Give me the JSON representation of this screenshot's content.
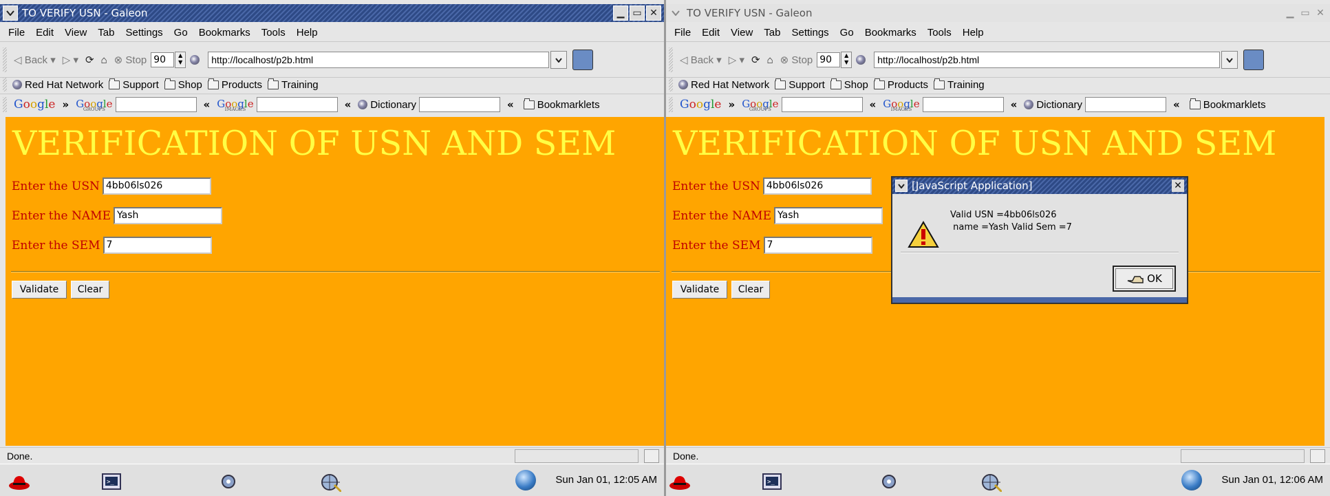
{
  "left": {
    "title": "TO VERIFY USN - Galeon",
    "menu": [
      "File",
      "Edit",
      "View",
      "Tab",
      "Settings",
      "Go",
      "Bookmarks",
      "Tools",
      "Help"
    ],
    "toolbar": {
      "back": "Back",
      "stop": "Stop",
      "zoom": "90",
      "url": "http://localhost/p2b.html"
    },
    "bookmarks": [
      "Red Hat Network",
      "Support",
      "Shop",
      "Products",
      "Training"
    ],
    "googlebar": {
      "dictionary": "Dictionary",
      "bookmarklets": "Bookmarklets",
      "chev": "»",
      "rev": "«",
      "groups": "GROUPS",
      "images": "IMAGES",
      "google": "Google"
    },
    "page": {
      "heading": "VERIFICATION OF USN AND SEM",
      "usn_label": "Enter the USN",
      "usn_value": "4bb06ls026",
      "name_label": "Enter the NAME",
      "name_value": "Yash",
      "sem_label": "Enter the SEM",
      "sem_value": "7",
      "validate": "Validate",
      "clear": "Clear"
    },
    "status": "Done.",
    "clock": "Sun Jan 01, 12:05 AM"
  },
  "right": {
    "title": "TO VERIFY USN - Galeon",
    "menu": [
      "File",
      "Edit",
      "View",
      "Tab",
      "Settings",
      "Go",
      "Bookmarks",
      "Tools",
      "Help"
    ],
    "toolbar": {
      "back": "Back",
      "stop": "Stop",
      "zoom": "90",
      "url": "http://localhost/p2b.html"
    },
    "bookmarks": [
      "Red Hat Network",
      "Support",
      "Shop",
      "Products",
      "Training"
    ],
    "googlebar": {
      "dictionary": "Dictionary",
      "bookmarklets": "Bookmarklets",
      "chev": "»",
      "rev": "«",
      "groups": "GROUPS",
      "images": "IMAGES",
      "google": "Google"
    },
    "page": {
      "heading": "VERIFICATION OF USN AND SEM",
      "usn_label": "Enter the USN",
      "usn_value": "4bb06ls026",
      "name_label": "Enter the NAME",
      "name_value": "Yash",
      "sem_label": "Enter the SEM",
      "sem_value": "7",
      "validate": "Validate",
      "clear": "Clear"
    },
    "status": "Done.",
    "clock": "Sun Jan 01, 12:06 AM"
  },
  "dialog": {
    "title": "[JavaScript Application]",
    "message": "Valid USN =4bb06ls026\n name =Yash Valid Sem =7",
    "ok": "OK"
  },
  "colors": {
    "page_bg": "#ffa500",
    "heading": "#ffff44",
    "label": "#c00000",
    "titlebar": "#2e4a86"
  }
}
